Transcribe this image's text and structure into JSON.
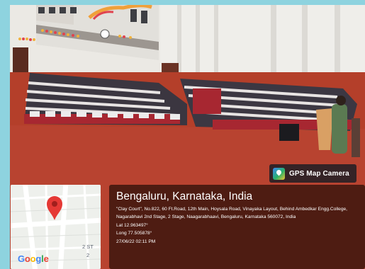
{
  "overlay": {
    "app_name": "GPS Map Camera",
    "city": "Bengaluru, Karnataka, India",
    "address": "\"Clay Court\", No.822, 60 Ft.Road, 12th Main, Hoysala Road, Vinayaka Layout, Behind Ambedkar Engg.College, Nagarabhavi 2nd Stage, 2 Stage, Naagarabhaavi, Bengaluru, Karnataka 560072, India",
    "latitude": "Lat 12.963497°",
    "longitude": "Long 77.505878°",
    "datetime": "27/06/22 02:11 PM"
  },
  "map": {
    "brand": [
      "G",
      "o",
      "o",
      "g",
      "l",
      "e"
    ],
    "brand_colors": [
      "#4285f4",
      "#ea4335",
      "#fbbc05",
      "#4285f4",
      "#34a853",
      "#ea4335"
    ],
    "road_label": "2 ST",
    "road_label_2": "2",
    "pin_icon": "map-pin-icon",
    "pin_color": "#e53935"
  },
  "colors": {
    "frame": "#8ed3df",
    "panel": "#3c160e",
    "floor": "#b03a26",
    "seat": "#a82630"
  }
}
